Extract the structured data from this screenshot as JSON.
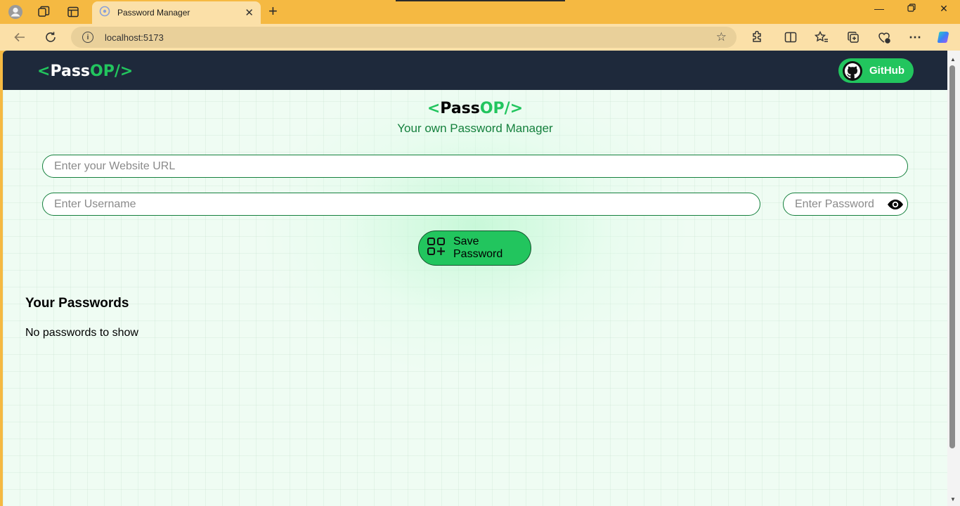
{
  "browser": {
    "tab_title": "Password Manager",
    "url": "localhost:5173"
  },
  "navbar": {
    "brand_open": "<",
    "brand_pass": "Pass",
    "brand_op": "OP/>",
    "github_label": "GitHub"
  },
  "hero": {
    "brand_open": "<",
    "brand_pass": "Pass",
    "brand_op": "OP/>",
    "subtitle": "Your own Password Manager"
  },
  "form": {
    "url_placeholder": "Enter your Website URL",
    "username_placeholder": "Enter Username",
    "password_placeholder": "Enter Password",
    "save_label": "Save Password"
  },
  "passwords": {
    "title": "Your Passwords",
    "empty_message": "No passwords to show"
  },
  "colors": {
    "accent": "#22c55e",
    "navbar": "#1e293b",
    "subtitle": "#15803d",
    "browser_frame": "#f5b942"
  }
}
